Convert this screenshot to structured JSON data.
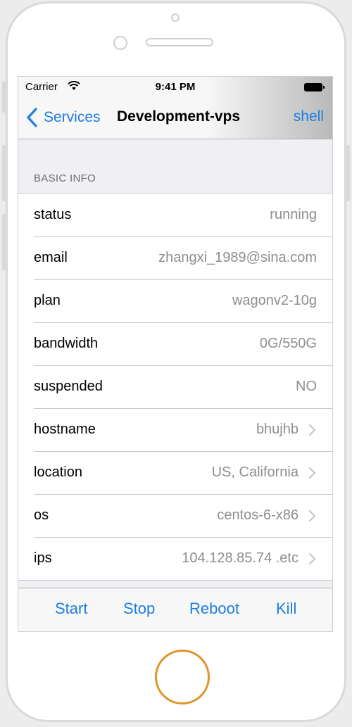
{
  "status_bar": {
    "carrier": "Carrier",
    "time": "9:41 PM",
    "wifi_icon": "wifi-icon",
    "battery_icon": "battery-icon"
  },
  "nav": {
    "back_label": "Services",
    "back_icon": "chevron-left-icon",
    "title": "Development-vps",
    "right_label": "shell"
  },
  "section": {
    "header": "BASIC INFO"
  },
  "rows": [
    {
      "key": "status",
      "value": "running",
      "disclosure": false
    },
    {
      "key": "email",
      "value": "zhangxi_1989@sina.com",
      "disclosure": false
    },
    {
      "key": "plan",
      "value": "wagonv2-10g",
      "disclosure": false
    },
    {
      "key": "bandwidth",
      "value": "0G/550G",
      "disclosure": false
    },
    {
      "key": "suspended",
      "value": "NO",
      "disclosure": false
    },
    {
      "key": "hostname",
      "value": "bhujhb",
      "disclosure": true
    },
    {
      "key": "location",
      "value": "US, California",
      "disclosure": true
    },
    {
      "key": "os",
      "value": "centos-6-x86",
      "disclosure": true
    },
    {
      "key": "ips",
      "value": "104.128.85.74 .etc",
      "disclosure": true
    }
  ],
  "toolbar": {
    "start": "Start",
    "stop": "Stop",
    "reboot": "Reboot",
    "kill": "Kill"
  },
  "colors": {
    "accent": "#1f7ee0",
    "home_button_ring": "#dd9527",
    "secondary_text": "#8e8e93",
    "grouped_background": "#efeff4"
  }
}
